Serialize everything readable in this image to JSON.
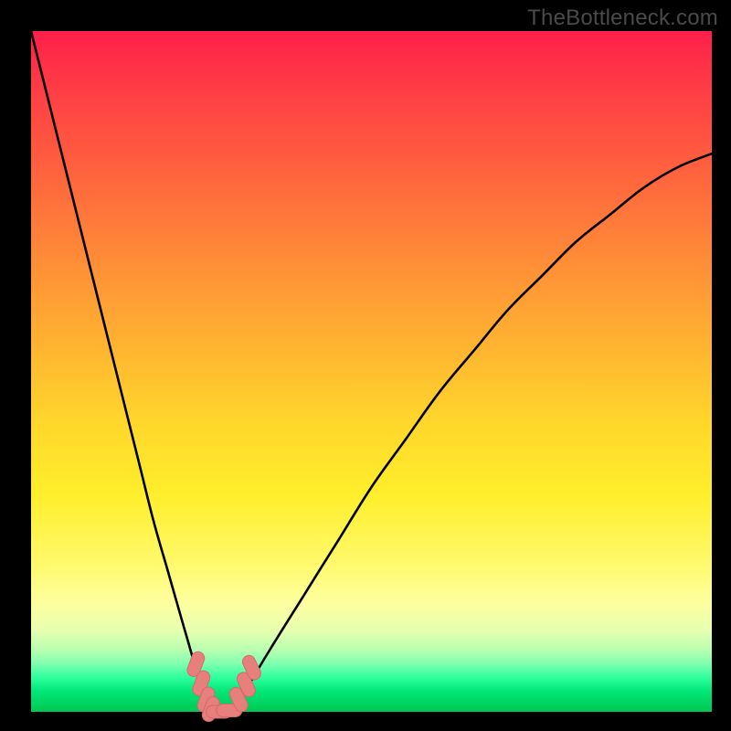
{
  "watermark": "TheBottleneck.com",
  "colors": {
    "frame": "#000000",
    "curve": "#000000",
    "marker_fill": "#e77f7d",
    "marker_stroke": "#d46a68"
  },
  "chart_data": {
    "type": "line",
    "title": "",
    "xlabel": "",
    "ylabel": "",
    "xlim": [
      0,
      100
    ],
    "ylim": [
      0,
      100
    ],
    "series": [
      {
        "name": "bottleneck-curve",
        "x": [
          0,
          2,
          4,
          6,
          8,
          10,
          12,
          14,
          16,
          18,
          20,
          22,
          24,
          25,
          26,
          27,
          28,
          29,
          30,
          32,
          35,
          40,
          45,
          50,
          55,
          60,
          65,
          70,
          75,
          80,
          85,
          90,
          95,
          100
        ],
        "y": [
          100,
          92,
          84,
          76,
          68,
          60,
          52,
          44,
          36,
          28,
          21,
          14,
          7,
          3,
          1,
          0,
          0,
          0,
          1,
          4,
          9,
          17,
          25,
          33,
          40,
          47,
          53,
          59,
          64,
          69,
          73,
          77,
          80,
          82
        ]
      }
    ],
    "markers": [
      {
        "x": 24.2,
        "y": 7.0
      },
      {
        "x": 25.0,
        "y": 4.2
      },
      {
        "x": 25.7,
        "y": 1.8
      },
      {
        "x": 26.4,
        "y": 0.4
      },
      {
        "x": 27.6,
        "y": 0.0
      },
      {
        "x": 29.1,
        "y": 0.2
      },
      {
        "x": 30.5,
        "y": 1.8
      },
      {
        "x": 31.6,
        "y": 4.0
      },
      {
        "x": 32.4,
        "y": 6.5
      }
    ]
  }
}
